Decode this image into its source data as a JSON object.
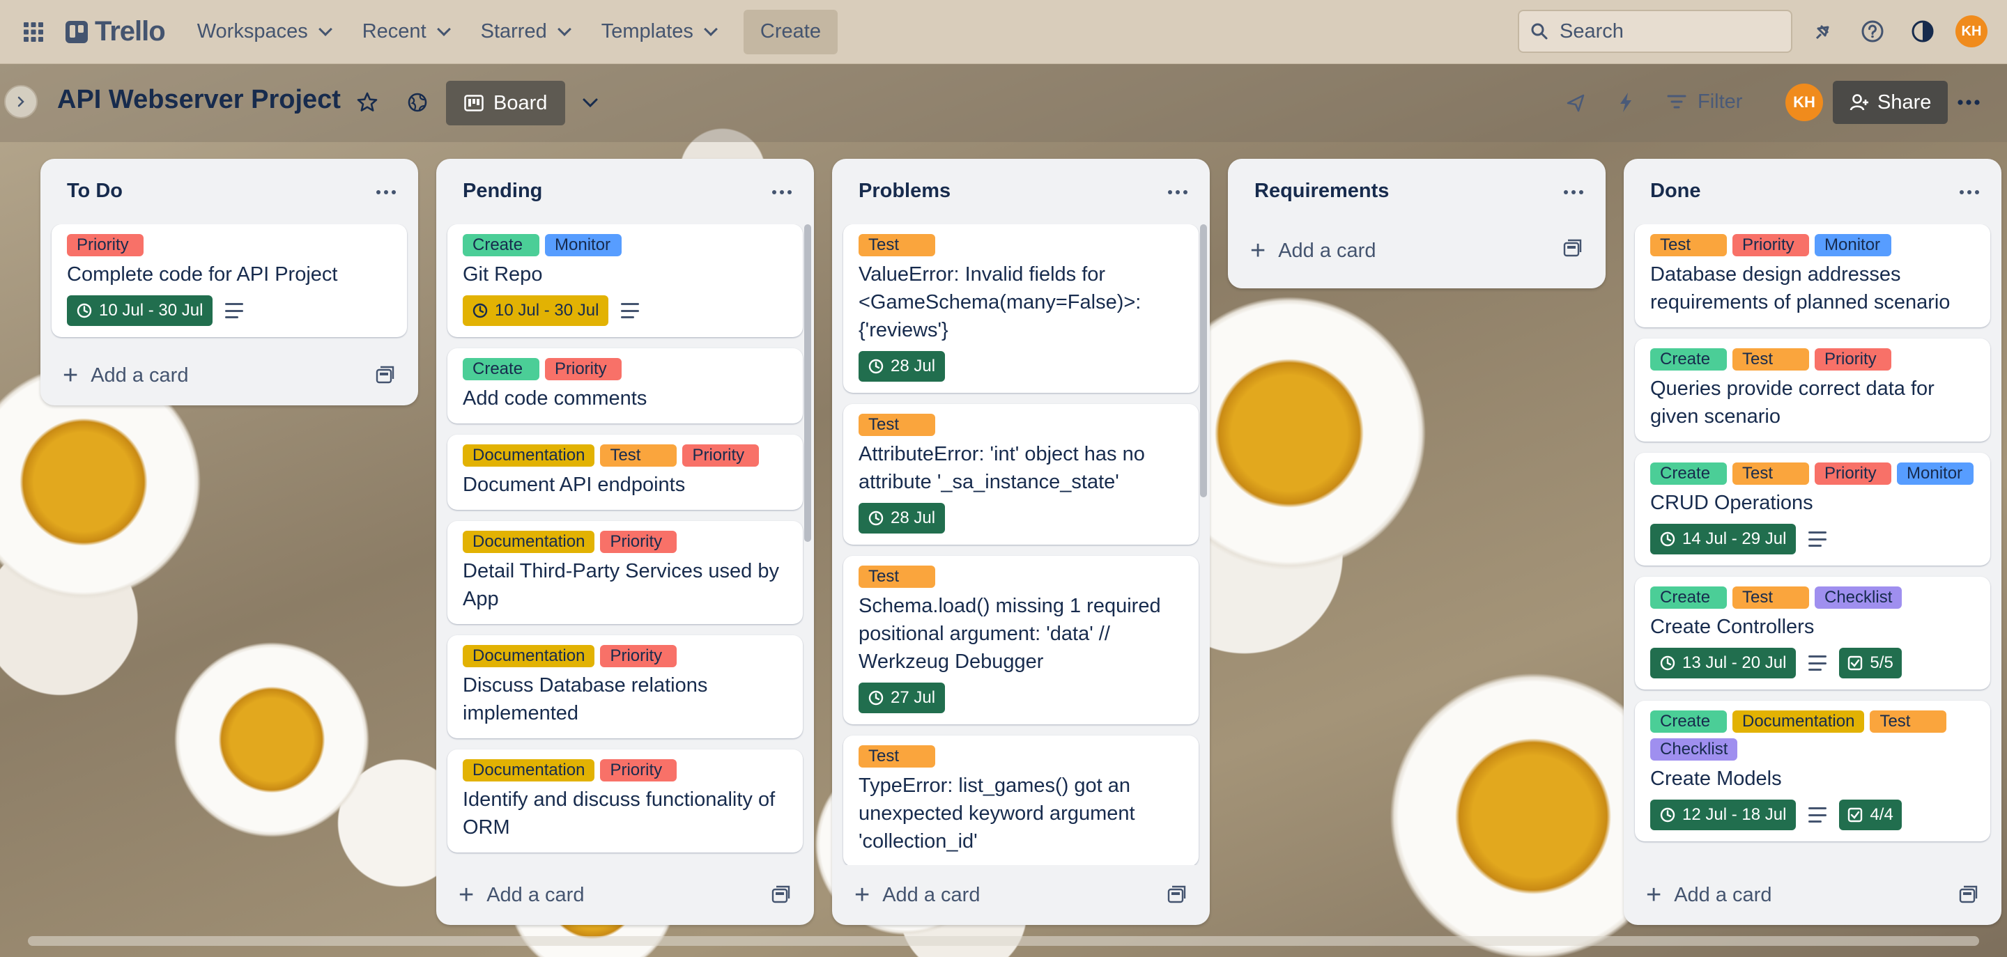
{
  "colors": {
    "priority": "#f87168",
    "create": "#4bce97",
    "monitor": "#579dff",
    "documentation": "#e2b203",
    "test": "#faa53d",
    "checklist": "#9f8fef",
    "date_green": "#216e4e",
    "date_yellow": "#e2b203"
  },
  "topbar": {
    "logo": "Trello",
    "nav": [
      "Workspaces",
      "Recent",
      "Starred",
      "Templates"
    ],
    "create": "Create",
    "search_placeholder": "Search",
    "avatar": "KH"
  },
  "board": {
    "title": "API Webserver Project",
    "view": "Board",
    "filter": "Filter",
    "avatar": "KH",
    "share": "Share"
  },
  "lists": [
    {
      "title": "To Do",
      "add": "Add a card",
      "cards": [
        {
          "labels": [
            {
              "text": "Priority",
              "color": "priority"
            }
          ],
          "title": "Complete code for API Project",
          "date": "10 Jul - 30 Jul",
          "date_style": "green",
          "description": true
        }
      ]
    },
    {
      "title": "Pending",
      "add": "Add a card",
      "cards": [
        {
          "labels": [
            {
              "text": "Create",
              "color": "create"
            },
            {
              "text": "Monitor",
              "color": "monitor"
            }
          ],
          "title": "Git Repo",
          "date": "10 Jul - 30 Jul",
          "date_style": "yellow",
          "description": true
        },
        {
          "labels": [
            {
              "text": "Create",
              "color": "create"
            },
            {
              "text": "Priority",
              "color": "priority"
            }
          ],
          "title": "Add code comments"
        },
        {
          "labels": [
            {
              "text": "Documentation",
              "color": "documentation"
            },
            {
              "text": "Test",
              "color": "test"
            },
            {
              "text": "Priority",
              "color": "priority"
            }
          ],
          "title": "Document API endpoints"
        },
        {
          "labels": [
            {
              "text": "Documentation",
              "color": "documentation"
            },
            {
              "text": "Priority",
              "color": "priority"
            }
          ],
          "title": "Detail Third-Party Services used by App"
        },
        {
          "labels": [
            {
              "text": "Documentation",
              "color": "documentation"
            },
            {
              "text": "Priority",
              "color": "priority"
            }
          ],
          "title": "Discuss Database relations implemented"
        },
        {
          "labels": [
            {
              "text": "Documentation",
              "color": "documentation"
            },
            {
              "text": "Priority",
              "color": "priority"
            }
          ],
          "title": "Identify and discuss functionality of ORM"
        }
      ]
    },
    {
      "title": "Problems",
      "add": "Add a card",
      "cards": [
        {
          "labels": [
            {
              "text": "Test",
              "color": "test"
            }
          ],
          "title": "ValueError: Invalid fields for <GameSchema(many=False)>: {'reviews'}",
          "date": "28 Jul",
          "date_style": "green"
        },
        {
          "labels": [
            {
              "text": "Test",
              "color": "test"
            }
          ],
          "title": "AttributeError: 'int' object has no attribute '_sa_instance_state'",
          "date": "28 Jul",
          "date_style": "green"
        },
        {
          "labels": [
            {
              "text": "Test",
              "color": "test"
            }
          ],
          "title": "Schema.load() missing 1 required positional argument: 'data' // Werkzeug Debugger",
          "date": "27 Jul",
          "date_style": "green"
        },
        {
          "labels": [
            {
              "text": "Test",
              "color": "test"
            }
          ],
          "title": "TypeError: list_games() got an unexpected keyword argument 'collection_id'"
        }
      ]
    },
    {
      "title": "Requirements",
      "add": "Add a card",
      "cards": []
    },
    {
      "title": "Done",
      "add": "Add a card",
      "cards": [
        {
          "labels": [
            {
              "text": "Test",
              "color": "test"
            },
            {
              "text": "Priority",
              "color": "priority"
            },
            {
              "text": "Monitor",
              "color": "monitor"
            }
          ],
          "title": "Database design addresses requirements of planned scenario"
        },
        {
          "labels": [
            {
              "text": "Create",
              "color": "create"
            },
            {
              "text": "Test",
              "color": "test"
            },
            {
              "text": "Priority",
              "color": "priority"
            }
          ],
          "title": "Queries provide correct data for given scenario"
        },
        {
          "labels": [
            {
              "text": "Create",
              "color": "create"
            },
            {
              "text": "Test",
              "color": "test"
            },
            {
              "text": "Priority",
              "color": "priority"
            },
            {
              "text": "Monitor",
              "color": "monitor"
            }
          ],
          "title": "CRUD Operations",
          "date": "14 Jul - 29 Jul",
          "date_style": "green",
          "description": true
        },
        {
          "labels": [
            {
              "text": "Create",
              "color": "create"
            },
            {
              "text": "Test",
              "color": "test"
            },
            {
              "text": "Checklist",
              "color": "checklist"
            }
          ],
          "title": "Create Controllers",
          "date": "13 Jul - 20 Jul",
          "date_style": "green",
          "description": true,
          "checklist": "5/5"
        },
        {
          "labels": [
            {
              "text": "Create",
              "color": "create"
            },
            {
              "text": "Documentation",
              "color": "documentation"
            },
            {
              "text": "Test",
              "color": "test"
            },
            {
              "text": "Checklist",
              "color": "checklist"
            }
          ],
          "title": "Create Models",
          "date": "12 Jul - 18 Jul",
          "date_style": "green",
          "description": true,
          "checklist": "4/4"
        }
      ]
    }
  ]
}
